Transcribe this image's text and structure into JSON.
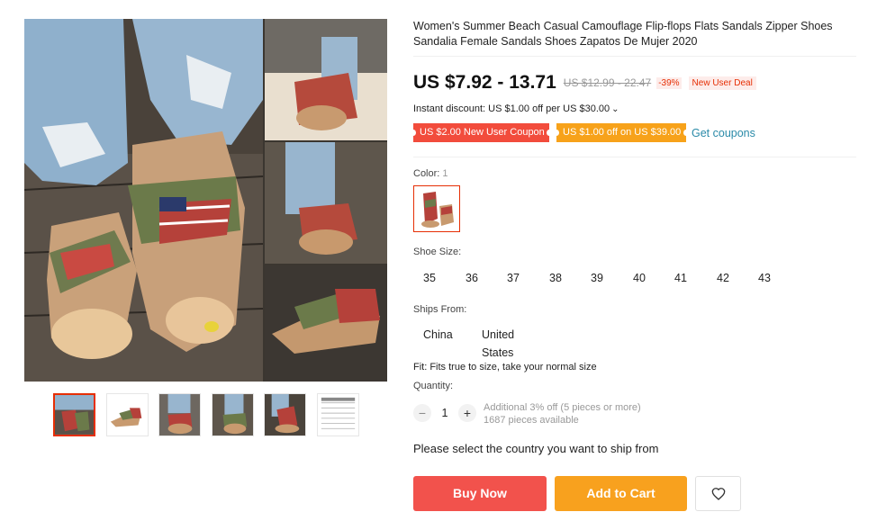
{
  "product": {
    "title": "Women's Summer Beach Casual Camouflage Flip-flops Flats Sandals Zipper Shoes Sandalia Female Sandals Shoes Zapatos De Mujer 2020"
  },
  "gallery": {
    "main_image": "camouflage-sandals-photo",
    "thumbnails": [
      {
        "name": "thumb-worn-front",
        "selected": true
      },
      {
        "name": "thumb-pair-side",
        "selected": false
      },
      {
        "name": "thumb-worn-top",
        "selected": false
      },
      {
        "name": "thumb-worn-angle",
        "selected": false
      },
      {
        "name": "thumb-worn-side",
        "selected": false
      },
      {
        "name": "thumb-size-chart",
        "selected": false
      }
    ]
  },
  "price": {
    "current": "US $7.92 - 13.71",
    "original": "US $12.99 - 22.47",
    "discount": "-39%",
    "deal": "New User Deal"
  },
  "discounts": {
    "instant": "Instant discount: US $1.00 off per US $30.00",
    "chevron": "⌄",
    "coupon_new_user": "US $2.00 New User Coupon",
    "coupon_store": "US $1.00 off on US $39.00",
    "get_coupons": "Get coupons"
  },
  "color": {
    "label": "Color:",
    "count": "1"
  },
  "size": {
    "label": "Shoe Size:",
    "options": [
      "35",
      "36",
      "37",
      "38",
      "39",
      "40",
      "41",
      "42",
      "43"
    ]
  },
  "ships_from": {
    "label": "Ships From:",
    "options": [
      "China",
      "United States"
    ]
  },
  "fit": "Fit: Fits true to size, take your normal size",
  "quantity": {
    "label": "Quantity:",
    "value": "1",
    "minus": "−",
    "plus": "+",
    "additional": "Additional 3% off (5 pieces or more)",
    "available": "1687 pieces available"
  },
  "ship_message": "Please select the country you want to ship from",
  "actions": {
    "buy_now": "Buy Now",
    "add_to_cart": "Add to Cart",
    "wishlist_icon": "heart-icon"
  },
  "colors": {
    "accent_red": "#f2524c",
    "accent_orange": "#f8a11e",
    "link": "#2a8aa8"
  }
}
